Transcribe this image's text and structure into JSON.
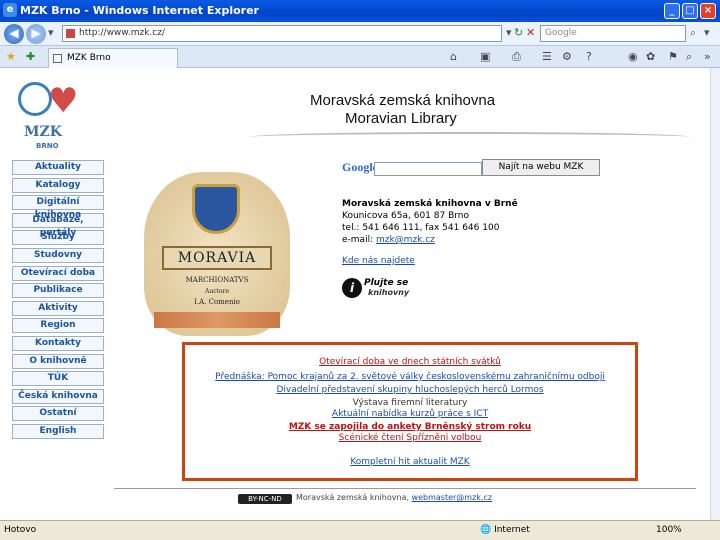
{
  "window": {
    "title": "MZK Brno - Windows Internet Explorer",
    "minimize": "_",
    "maximize": "□",
    "close": "×"
  },
  "address_bar": {
    "url": "http://www.mzk.cz/",
    "search_placeholder": "Google"
  },
  "tab": {
    "label": "MZK Brno"
  },
  "header": {
    "logo_text": "MZK",
    "logo_sub": "BRNO",
    "title_cs": "Moravská zemská knihovna",
    "title_en": "Moravian Library"
  },
  "menu": [
    "Aktuality",
    "Katalogy",
    "Digitální knihovna",
    "Databáze, portály",
    "Služby",
    "Studovny",
    "Otevírací doba",
    "Publikace",
    "Aktivity",
    "Region",
    "Kontakty",
    "O knihovně",
    "TÚK",
    "Česká knihovna",
    "Ostatní",
    "English"
  ],
  "map": {
    "banner": "MORAVIA",
    "line1": "MARCHIONATVS",
    "line2": "Auctore",
    "line3": "I.A. Comenio"
  },
  "google": {
    "logo": "Google",
    "button": "Najít na webu MZK"
  },
  "contact": {
    "name": "Moravská zemská knihovna v Brně",
    "street": "Kounicova 65a, 601 87 Brno",
    "phone": "tel.: 541 646 111, fax 541 646 100",
    "email_label": "e-mail: ",
    "email": "mzk@mzk.cz",
    "find_us": "Kde nás najdete"
  },
  "iplay": {
    "icon": "i",
    "text1": "Plujte se",
    "text2": "knihovny"
  },
  "news": [
    {
      "text": "Otevírací doba ve dnech státních svátků",
      "style": "red"
    },
    {
      "text": "Přednáška: Pomoc krajanů za 2. světové války československému zahraničnímu odboji",
      "style": "blue"
    },
    {
      "text": "Divadelní představení skupiny hluchoslepých herců Lormos",
      "style": "blue"
    },
    {
      "text": "Výstava firemní literatury",
      "style": "dark"
    },
    {
      "text": "Aktuální nabídka kurzů práce s ICT",
      "style": "blue"
    },
    {
      "text": "MZK se zapojila do ankety Brněnský strom roku",
      "style": "red2"
    },
    {
      "text": "Scénické čtení Spřízněni volbou",
      "style": "red"
    },
    {
      "text": "Kompletní hit aktualit MZK",
      "style": "blue"
    }
  ],
  "footer": {
    "badge": "BY-NC-ND",
    "text": "Moravská zemská knihovna, ",
    "link": "webmaster@mzk.cz"
  },
  "status": {
    "left": "Hotovo",
    "zone": "Internet",
    "zoom": "100%"
  },
  "colors": {
    "titlebar": "#0a5ae4",
    "menu_text": "#1a56a0",
    "news_border": "#cc4411",
    "link": "#1a4ab8",
    "red_link": "#c01010"
  }
}
